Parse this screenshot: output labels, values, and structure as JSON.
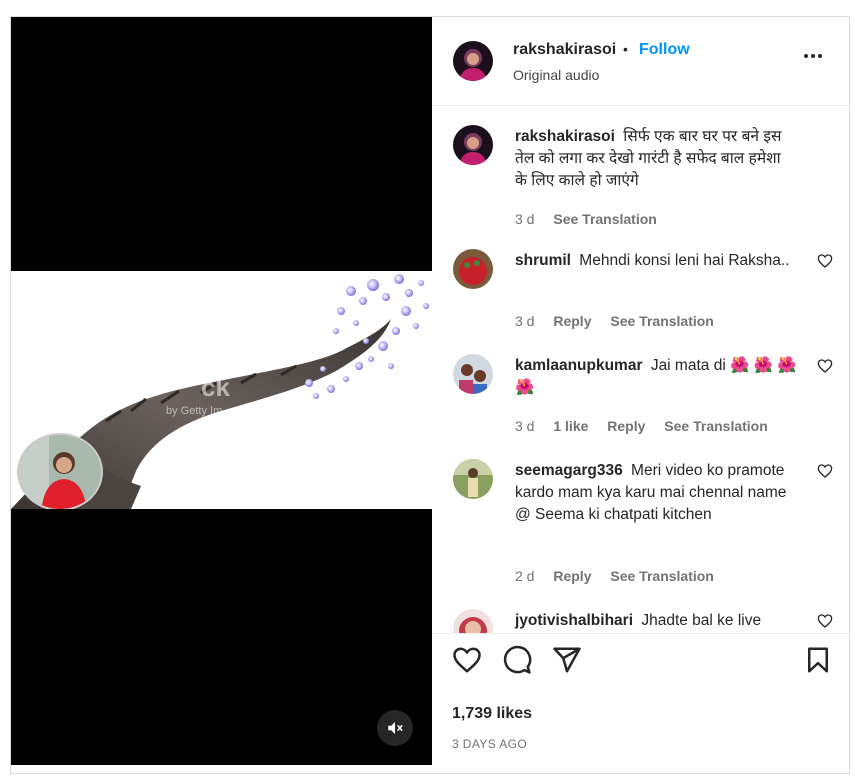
{
  "post": {
    "username": "rakshakirasoi",
    "separator": "•",
    "follow_label": "Follow",
    "audio": "Original audio",
    "caption": "सिर्फ एक बार घर पर बने इस तेल को लगा कर देखो गारंटी है सफेद बाल हमेशा के लिए काले हो जाएंगे",
    "caption_time": "3 d",
    "caption_translate": "See Translation",
    "likes": "1,739 likes",
    "date": "3 DAYS AGO"
  },
  "media": {
    "watermark": "ck",
    "watermark_sub": "by Getty Im"
  },
  "comments": [
    {
      "user": "shrumil",
      "text": "Mehndi konsi leni hai Raksha..",
      "time": "3 d",
      "likes": "",
      "reply": "Reply",
      "translate": "See Translation"
    },
    {
      "user": "kamlaanupkumar",
      "text": "Jai mata di 🌺 🌺 🌺 🌺",
      "time": "3 d",
      "likes": "1 like",
      "reply": "Reply",
      "translate": "See Translation"
    },
    {
      "user": "seemagarg336",
      "text": "Meri video ko pramote kardo mam kya karu mai chennal name @ Seema ki chatpati kitchen",
      "time": "2 d",
      "likes": "",
      "reply": "Reply",
      "translate": "See Translation"
    },
    {
      "user": "jyotivishalbihari",
      "text": "Jhadte bal ke live",
      "time": "",
      "likes": "",
      "reply": "",
      "translate": ""
    }
  ],
  "icons": {
    "like": "heart-icon",
    "comment": "comment-icon",
    "share": "share-icon",
    "save": "bookmark-icon",
    "mute": "speaker-muted-icon",
    "more": "more-icon"
  },
  "colors": {
    "accent": "#0095f6",
    "muted": "#737373",
    "text": "#262626"
  }
}
